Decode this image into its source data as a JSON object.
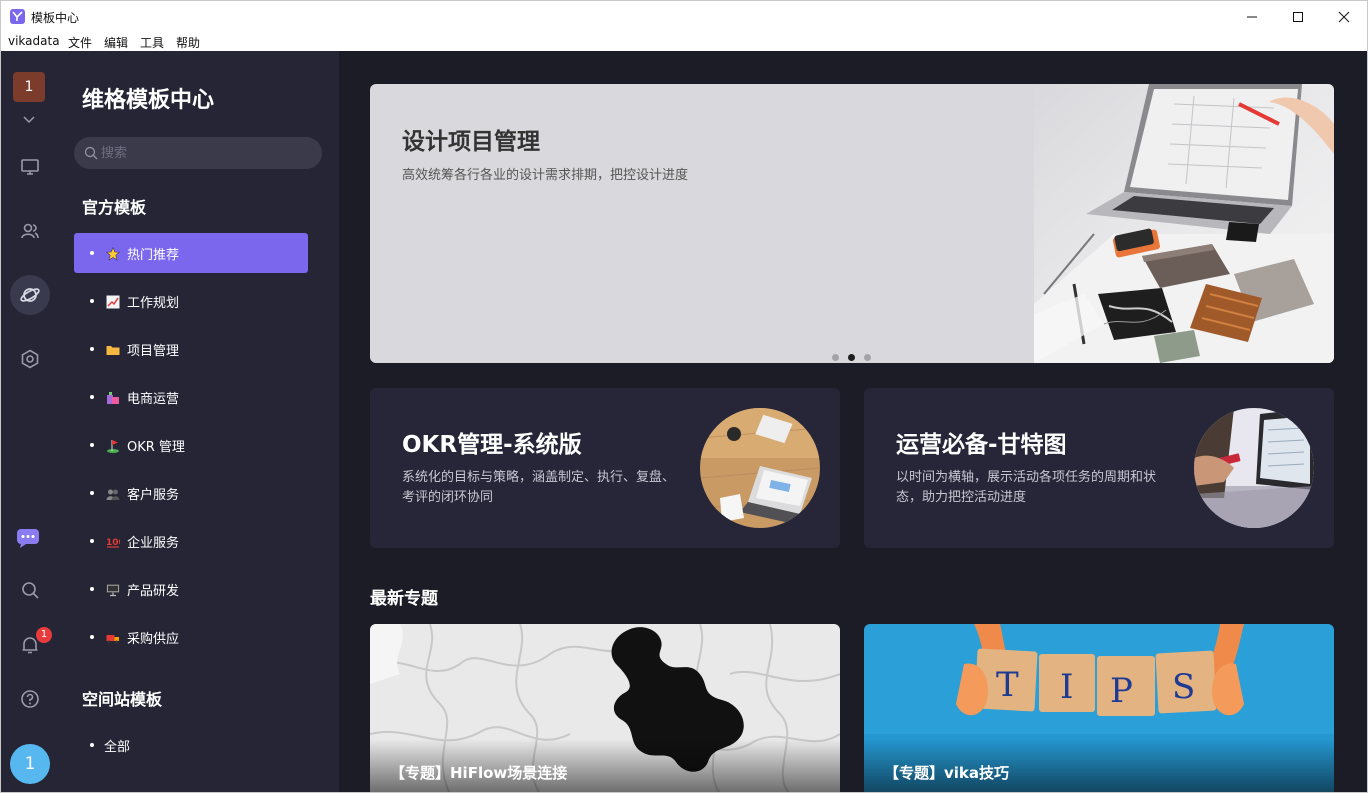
{
  "window": {
    "title": "模板中心"
  },
  "menubar": {
    "items": [
      "vikadata",
      "文件",
      "编辑",
      "工具",
      "帮助"
    ]
  },
  "rail": {
    "space_label": "1",
    "notification_count": "1",
    "avatar_initial": "1"
  },
  "panel": {
    "title": "维格模板中心",
    "search_placeholder": "搜索",
    "official_header": "官方模板",
    "official_items": [
      {
        "label": "热门推荐",
        "icon": "star-emoji",
        "active": true
      },
      {
        "label": "工作规划",
        "icon": "chart-emoji",
        "active": false
      },
      {
        "label": "项目管理",
        "icon": "folder-emoji",
        "active": false
      },
      {
        "label": "电商运营",
        "icon": "shopping-emoji",
        "active": false
      },
      {
        "label": "OKR 管理",
        "icon": "golf-flag-emoji",
        "active": false
      },
      {
        "label": "客户服务",
        "icon": "people-emoji",
        "active": false
      },
      {
        "label": "企业服务",
        "icon": "hundred-emoji",
        "active": false
      },
      {
        "label": "产品研发",
        "icon": "computer-emoji",
        "active": false
      },
      {
        "label": "采购供应",
        "icon": "truck-emoji",
        "active": false
      }
    ],
    "space_header": "空间站模板",
    "space_items": [
      {
        "label": "全部"
      }
    ]
  },
  "main": {
    "banner": {
      "title": "设计项目管理",
      "desc": "高效统筹各行各业的设计需求排期，把控设计进度",
      "slides": 3,
      "active_slide": 2
    },
    "cards": [
      {
        "title": "OKR管理-系统版",
        "desc": "系统化的目标与策略，涵盖制定、执行、复盘、考评的闭环协同"
      },
      {
        "title": "运营必备-甘特图",
        "desc": "以时间为横轴，展示活动各项任务的周期和状态，助力把控活动进度"
      }
    ],
    "topics_header": "最新专题",
    "topics": [
      {
        "title": "【专题】HiFlow场景连接"
      },
      {
        "title": "【专题】vika技巧"
      }
    ]
  },
  "colors": {
    "accent": "#7b67ee",
    "rail_bg": "#252535",
    "main_bg": "#1c1c26",
    "card_bg": "#262638",
    "badge": "#e83b3b"
  }
}
